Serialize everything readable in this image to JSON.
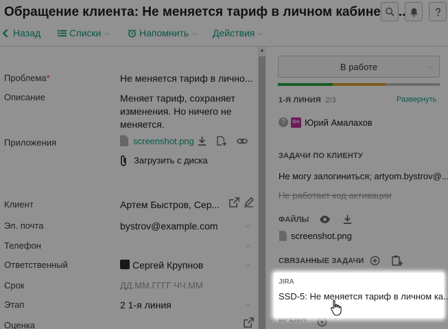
{
  "header": {
    "title": "Обращение клиента: Не меняется тариф в личном кабинете;...",
    "search_icon": "search-icon",
    "bell_icon": "bell-icon",
    "help_icon": "help-icon"
  },
  "toolbar": {
    "back": "Назад",
    "lists": "Списки",
    "remind": "Напомнить",
    "actions": "Действия"
  },
  "form": {
    "problem_label": "Проблема",
    "required_mark": "*",
    "problem_value": "Не меняется тариф в лично...",
    "description_label": "Описание",
    "description_value": "Меняет тариф, сохраняет изменения. Но ничего не меняется.",
    "attachments_label": "Приложения",
    "attachment_file": "screenshot.png",
    "upload_label": "Загрузить с диска",
    "client_label": "Клиент",
    "client_value": "Артем Быстров, Сер...",
    "email_label": "Эл. почта",
    "email_value": "bystrov@example.com",
    "phone_label": "Телефон",
    "assignee_label": "Ответственный",
    "assignee_value": "Сергей Крупнов",
    "deadline_label": "Срок",
    "deadline_placeholder": "ДД.ММ.ГГГГ ЧЧ:ММ",
    "stage_label": "Этап",
    "stage_value": "2 1-я линия",
    "rating_label": "Оценка"
  },
  "side": {
    "status": "В работе",
    "progress_colors": [
      "#27a33a",
      "#e0a02a",
      "#bdbdbd"
    ],
    "line_title": "1-Я ЛИНИЯ",
    "line_count": "2/3",
    "expand": "Развернуть",
    "avatar_initials": "IDA",
    "user_name": "Юрий Амалахов",
    "client_tasks_title": "ЗАДАЧИ ПО КЛИЕНТУ",
    "task_1": "Не могу залогиниться; artyom.bystrov@...",
    "task_2": "Не работает код активации",
    "files_title": "ФАЙЛЫ",
    "file_name": "screenshot.png",
    "related_title": "СВЯЗАННЫЕ ЗАДАЧИ",
    "jira_label": "JIRA",
    "jira_task": "SSD-5: Не меняется тариф в личном ка...",
    "time_title": "ВРЕМЯ"
  }
}
